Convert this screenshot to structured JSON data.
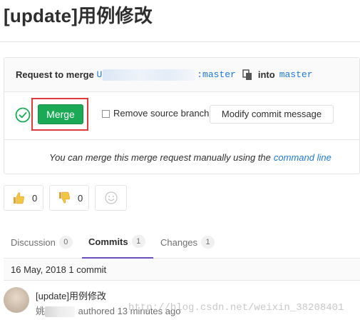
{
  "page": {
    "title": "[update]用例修改"
  },
  "merge_request": {
    "request_prefix": "Request to merge",
    "source_branch_prefix": "U",
    "source_branch_suffix": ":master",
    "into_label": "into",
    "target_branch": "master",
    "merge_button": "Merge",
    "remove_source_branch_label": "Remove source branch",
    "remove_source_branch_checked": false,
    "modify_commit_button": "Modify commit message",
    "manual_text": "You can merge this merge request manually using the",
    "command_line_link": "command line"
  },
  "awards": {
    "thumbs_up_count": "0",
    "thumbs_down_count": "0"
  },
  "tabs": [
    {
      "label": "Discussion",
      "count": "0"
    },
    {
      "label": "Commits",
      "count": "1"
    },
    {
      "label": "Changes",
      "count": "1"
    }
  ],
  "commits": {
    "date_header": "16 May, 2018 1 commit",
    "items": [
      {
        "title": "[update]用例修改",
        "author_initial": "姚",
        "meta": "authored 13 minutes ago"
      }
    ]
  },
  "watermark": "http://blog.csdn.net/weixin_38208401",
  "colors": {
    "merge_green": "#1aaa55",
    "link_blue": "#1f78d1",
    "active_tab_underline": "#6b4fbb",
    "highlight_red": "#db3b3b"
  }
}
